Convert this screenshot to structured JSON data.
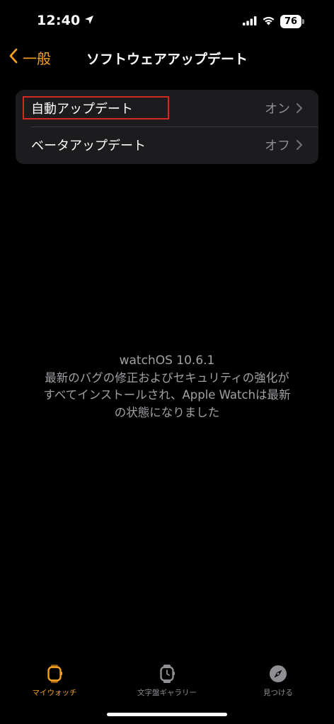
{
  "status_bar": {
    "time": "12:40",
    "battery_level": "76"
  },
  "nav": {
    "back_label": "一般",
    "title": "ソフトウェアアップデート"
  },
  "settings": {
    "rows": [
      {
        "label": "自動アップデート",
        "value": "オン"
      },
      {
        "label": "ベータアップデート",
        "value": "オフ"
      }
    ]
  },
  "info": {
    "version": "watchOS 10.6.1",
    "message_line1": "最新のバグの修正およびセキュリティの強化が",
    "message_line2": "すべてインストールされ、Apple Watchは最新",
    "message_line3": "の状態になりました"
  },
  "tab_bar": {
    "tabs": [
      {
        "label": "マイウォッチ",
        "icon": "watch-icon",
        "active": true
      },
      {
        "label": "文字盤ギャラリー",
        "icon": "watch-face-icon",
        "active": false
      },
      {
        "label": "見つける",
        "icon": "compass-icon",
        "active": false
      }
    ]
  },
  "colors": {
    "accent": "#f4a020",
    "background": "#000000",
    "group_background": "#1c1c1e",
    "secondary_text": "#8e8e93",
    "highlight": "#d02a22"
  }
}
